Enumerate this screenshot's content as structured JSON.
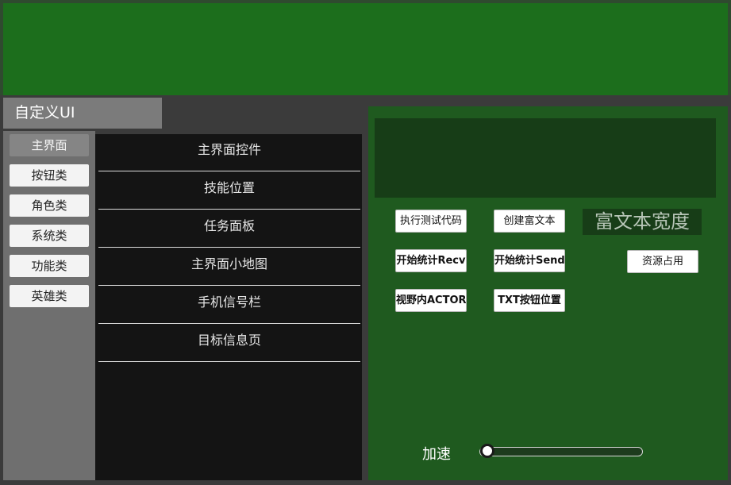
{
  "title": "自定义UI",
  "categories": [
    {
      "label": "主界面",
      "active": true
    },
    {
      "label": "按钮类",
      "active": false
    },
    {
      "label": "角色类",
      "active": false
    },
    {
      "label": "系统类",
      "active": false
    },
    {
      "label": "功能类",
      "active": false
    },
    {
      "label": "英雄类",
      "active": false
    }
  ],
  "list_items": [
    "主界面控件",
    "技能位置",
    "任务面板",
    "主界面小地图",
    "手机信号栏",
    "目标信息页"
  ],
  "actions": {
    "exec_test_code": "执行测试代码",
    "create_rich_text": "创建富文本",
    "rich_text_width": "富文本宽度",
    "start_stat_recv": "开始统计Recv",
    "start_stat_send": "开始统计Send",
    "resource_usage": "资源占用",
    "view_actor": "视野内ACTOR",
    "txt_button_position": "TXT按钮位置"
  },
  "speed": {
    "label": "加速",
    "value": 0.0
  },
  "colors": {
    "top_green": "#1c6e1c",
    "right_panel": "#1f5a1f",
    "list_panel": "#141414",
    "active_category": "#858585"
  }
}
